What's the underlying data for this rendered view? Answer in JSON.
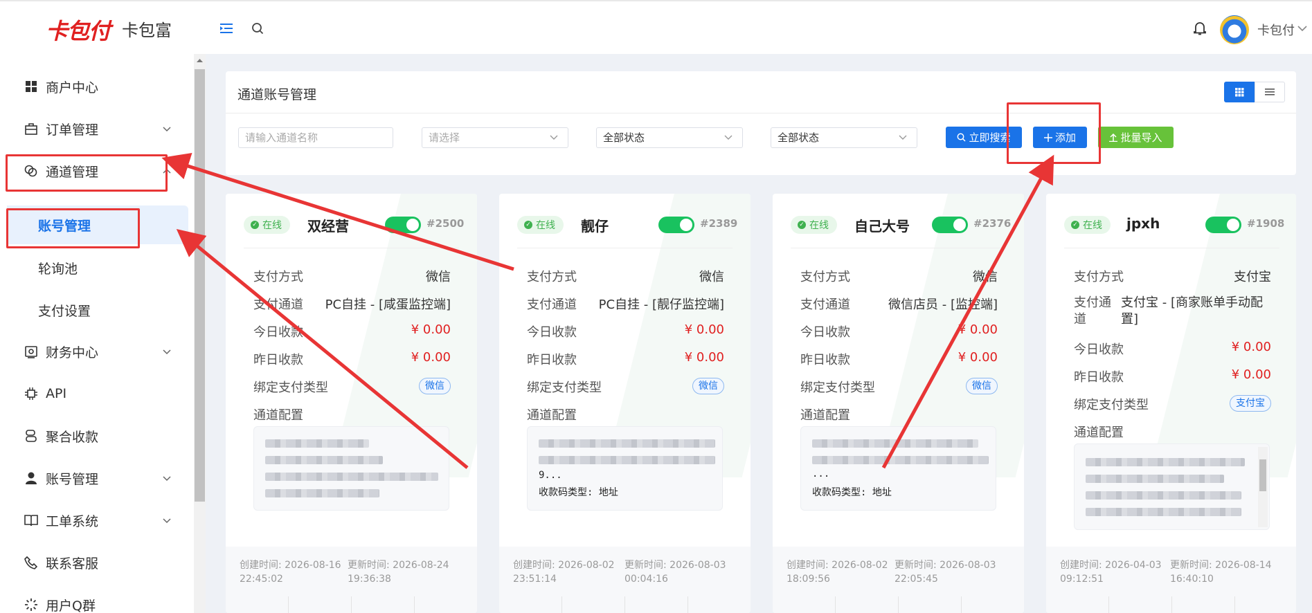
{
  "header": {
    "logo_text": "卡包付",
    "brand": "卡包富",
    "user_name": "卡包付",
    "icons": [
      "menu-fold-icon",
      "search-icon",
      "bell-icon",
      "chevron-down-icon"
    ]
  },
  "sidebar": {
    "items": [
      {
        "label": "商户中心",
        "icon": "grid-icon"
      },
      {
        "label": "订单管理",
        "icon": "bag-icon"
      },
      {
        "label": "通道管理",
        "icon": "link-icon"
      },
      {
        "label": "财务中心",
        "icon": "wallet-icon"
      },
      {
        "label": "API",
        "icon": "chip-icon"
      },
      {
        "label": "聚合收款",
        "icon": "cash-icon"
      },
      {
        "label": "账号管理",
        "icon": "user-icon"
      },
      {
        "label": "工单系统",
        "icon": "book-icon"
      },
      {
        "label": "联系客服",
        "icon": "phone-icon"
      },
      {
        "label": "用户Q群",
        "icon": "loading-icon"
      }
    ],
    "sub_items": [
      {
        "label": "账号管理",
        "active": true
      },
      {
        "label": "轮询池",
        "active": false
      },
      {
        "label": "支付设置",
        "active": false
      }
    ]
  },
  "page": {
    "title": "通道账号管理",
    "filters": {
      "name_placeholder": "请输入通道名称",
      "select_placeholder": "请选择",
      "status1": "全部状态",
      "status2": "全部状态"
    },
    "buttons": {
      "search": "立即搜索",
      "add": "添加",
      "import": "批量导入"
    }
  },
  "labels": {
    "status": "在线",
    "pay_method": "支付方式",
    "pay_channel": "支付通道",
    "today": "今日收款",
    "yesterday": "昨日收款",
    "bind_type": "绑定支付类型",
    "config": "通道配置"
  },
  "cards": [
    {
      "name": "双经营",
      "id": "#2500",
      "enabled": true,
      "pay_method": "微信",
      "pay_channel": "PC自挂 - [咸蛋监控端]",
      "today": "¥ 0.00",
      "yesterday": "¥ 0.00",
      "bind_type": "微信",
      "config_text": [],
      "created": "创建时间: 2026-08-16 22:45:02",
      "updated": "更新时间: 2026-08-24 19:36:38"
    },
    {
      "name": "靓仔",
      "id": "#2389",
      "enabled": true,
      "pay_method": "微信",
      "pay_channel": "PC自挂 - [靓仔监控端]",
      "today": "¥ 0.00",
      "yesterday": "¥ 0.00",
      "bind_type": "微信",
      "config_text": [
        "9...",
        "收款码类型: 地址"
      ],
      "created": "创建时间: 2026-08-02 23:51:14",
      "updated": "更新时间: 2026-08-03 00:04:16"
    },
    {
      "name": "自己大号",
      "id": "#2376",
      "enabled": true,
      "pay_method": "微信",
      "pay_channel": "微信店员 - [监控端]",
      "today": "¥ 0.00",
      "yesterday": "¥ 0.00",
      "bind_type": "微信",
      "config_text": [
        "...",
        "收款码类型: 地址"
      ],
      "created": "创建时间: 2026-08-02 18:09:56",
      "updated": "更新时间: 2026-08-03 22:05:45"
    },
    {
      "name": "jpxh",
      "id": "#1908",
      "enabled": true,
      "pay_method": "支付宝",
      "pay_channel": "支付宝 - [商家账单手动配置]",
      "today": "¥ 0.00",
      "yesterday": "¥ 0.00",
      "bind_type": "支付宝",
      "config_text": [],
      "created": "创建时间: 2026-04-03 09:12:51",
      "updated": "更新时间: 2026-08-14 16:40:10"
    }
  ],
  "colors": {
    "primary": "#1a73e8",
    "success": "#67c23a",
    "online": "#3fb14f",
    "toggle": "#19c25f",
    "money": "#e02020",
    "annotation": "#e83535"
  }
}
